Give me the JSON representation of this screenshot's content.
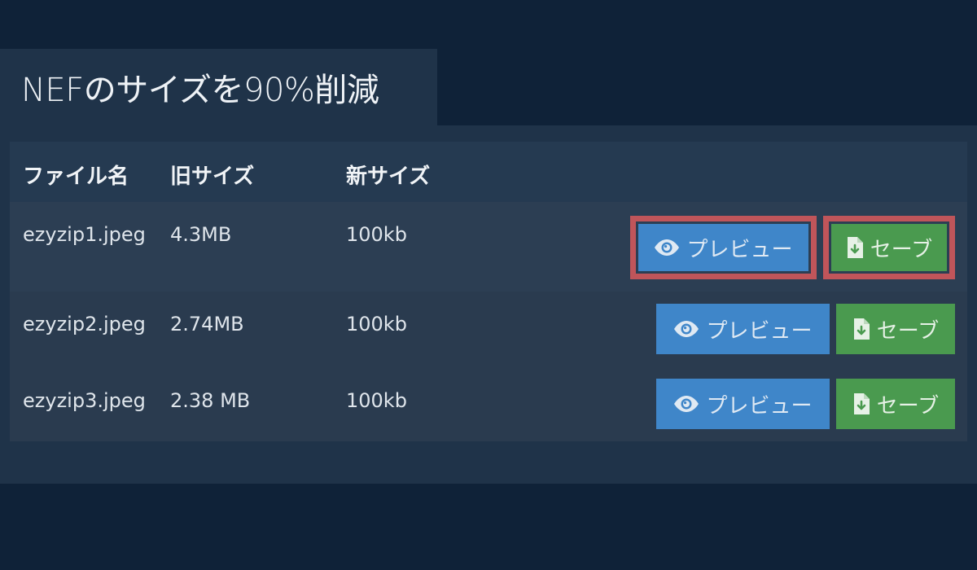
{
  "page": {
    "title": "NEFのサイズを90%削減"
  },
  "table": {
    "headers": {
      "filename": "ファイル名",
      "old_size": "旧サイズ",
      "new_size": "新サイズ"
    },
    "rows": [
      {
        "filename": "ezyzip1.jpeg",
        "old_size": "4.3MB",
        "new_size": "100kb",
        "preview_label": "プレビュー",
        "save_label": "セーブ"
      },
      {
        "filename": "ezyzip2.jpeg",
        "old_size": "2.74MB",
        "new_size": "100kb",
        "preview_label": "プレビュー",
        "save_label": "セーブ"
      },
      {
        "filename": "ezyzip3.jpeg",
        "old_size": "2.38 MB",
        "new_size": "100kb",
        "preview_label": "プレビュー",
        "save_label": "セーブ"
      }
    ]
  },
  "icons": {
    "preview": "eye-icon",
    "save": "file-download-icon"
  },
  "colors": {
    "background": "#0f2238",
    "panel": "#1f3349",
    "preview_button": "#3f86c9",
    "save_button": "#4a9a4f",
    "highlight": "#c0555a"
  }
}
